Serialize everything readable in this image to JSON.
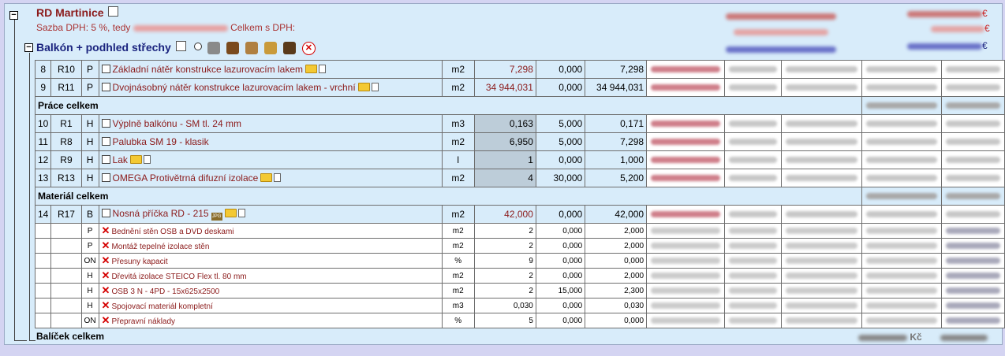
{
  "project": {
    "title": "RD Martinice",
    "vat_label": "Sazba DPH: 5 %, tedy",
    "vat_total_label": "Celkem s DPH:",
    "currency": "€"
  },
  "package": {
    "title": "Balkón + podhled střechy",
    "footer": "Balíček celkem",
    "footer_value_czk": "Kč"
  },
  "sections": {
    "work_total": "Práce celkem",
    "material_total": "Materiál celkem"
  },
  "items": [
    {
      "n": "8",
      "code": "R10",
      "type": "P",
      "name": "Základní nátěr konstrukce lazurovacím lakem",
      "unit": "m2",
      "qty": "7,298",
      "coef": "0,000",
      "total": "7,298",
      "icons": [
        "folder",
        "doc"
      ],
      "qty_style": "white"
    },
    {
      "n": "9",
      "code": "R11",
      "type": "P",
      "name": "Dvojnásobný nátěr konstrukce lazurovacím lakem - vrchní",
      "unit": "m2",
      "qty": "34 944,031",
      "coef": "0,000",
      "total": "34 944,031",
      "icons": [
        "folder",
        "doc"
      ],
      "qty_style": "white"
    },
    {
      "n": "10",
      "code": "R1",
      "type": "H",
      "name": "Výplně balkónu - SM tl. 24 mm",
      "unit": "m3",
      "qty": "0,163",
      "coef": "5,000",
      "total": "0,171",
      "icons": [],
      "qty_style": "gray"
    },
    {
      "n": "11",
      "code": "R8",
      "type": "H",
      "name": "Palubka SM 19 - klasik",
      "unit": "m2",
      "qty": "6,950",
      "coef": "5,000",
      "total": "7,298",
      "icons": [],
      "qty_style": "gray"
    },
    {
      "n": "12",
      "code": "R9",
      "type": "H",
      "name": "Lak",
      "unit": "l",
      "qty": "1",
      "coef": "0,000",
      "total": "1,000",
      "icons": [
        "folder",
        "doc"
      ],
      "qty_style": "gray"
    },
    {
      "n": "13",
      "code": "R13",
      "type": "H",
      "name": "OMEGA Protivětrná difuzní izolace",
      "unit": "m2",
      "qty": "4",
      "coef": "30,000",
      "total": "5,200",
      "icons": [
        "folder",
        "doc"
      ],
      "qty_style": "gray"
    },
    {
      "n": "14",
      "code": "R17",
      "type": "B",
      "name": "Nosná příčka RD - 215",
      "unit": "m2",
      "qty": "42,000",
      "coef": "0,000",
      "total": "42,000",
      "icons": [
        "jpg",
        "folder",
        "doc"
      ],
      "qty_style": "white"
    }
  ],
  "subitems": [
    {
      "type": "P",
      "name": "Bednění stěn OSB a DVD deskami",
      "unit": "m2",
      "qty": "2",
      "coef": "0,000",
      "total": "2,000"
    },
    {
      "type": "P",
      "name": "Montáž tepelné izolace stěn",
      "unit": "m2",
      "qty": "2",
      "coef": "0,000",
      "total": "2,000"
    },
    {
      "type": "ON",
      "name": "Přesuny kapacit",
      "unit": "%",
      "qty": "9",
      "coef": "0,000",
      "total": "0,000"
    },
    {
      "type": "H",
      "name": "Dřevitá izolace STEICO Flex tl. 80 mm",
      "unit": "m2",
      "qty": "2",
      "coef": "0,000",
      "total": "2,000"
    },
    {
      "type": "H",
      "name": "OSB 3 N - 4PD - 15x625x2500",
      "unit": "m2",
      "qty": "2",
      "coef": "15,000",
      "total": "2,300"
    },
    {
      "type": "H",
      "name": "Spojovací materiál kompletní",
      "unit": "m3",
      "qty": "0,030",
      "coef": "0,000",
      "total": "0,030"
    },
    {
      "type": "ON",
      "name": "Přepravní náklady",
      "unit": "%",
      "qty": "5",
      "coef": "0,000",
      "total": "0,000"
    }
  ],
  "icons": {
    "edit": "edit-icon",
    "radio": "radio-icon",
    "tools": [
      "hammer-icon",
      "bag-icon",
      "boxes-icon",
      "crate-icon",
      "truck-icon",
      "delete-icon"
    ],
    "toggle": "collapse-toggle-icon"
  },
  "colors": {
    "red": "#8b1a1a",
    "blue": "#1a237e",
    "background": "#d8ecfa",
    "qty_gray": "#bdcdd9"
  }
}
